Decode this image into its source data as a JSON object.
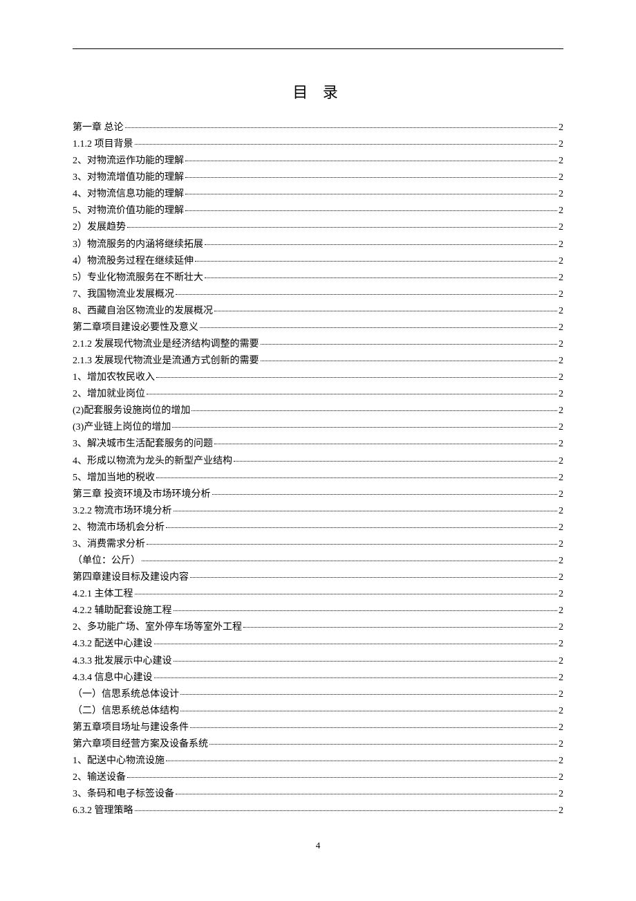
{
  "title": "目 录",
  "page_number": "4",
  "toc": [
    {
      "label": "第一章  总论",
      "page": "2"
    },
    {
      "label": "1.1.2   项目背景",
      "page": "2"
    },
    {
      "label": "2、对物流运作功能的理解",
      "page": "2"
    },
    {
      "label": "3、对物流增值功能的理解",
      "page": "2"
    },
    {
      "label": "4、对物流信息功能的理解",
      "page": "2"
    },
    {
      "label": "5、对物流价值功能的理解",
      "page": "2"
    },
    {
      "label": "2）发展趋势",
      "page": "2"
    },
    {
      "label": "3）物流服务的内涵将继续拓展",
      "page": "2"
    },
    {
      "label": "4）物流股务过程在继续延伸",
      "page": "2"
    },
    {
      "label": "5）专业化物流服务在不断壮大",
      "page": "2"
    },
    {
      "label": "7、我国物流业发展概况",
      "page": "2"
    },
    {
      "label": "8、西藏自治区物流业的发展概况",
      "page": "2"
    },
    {
      "label": "第二章项目建设必要性及意义",
      "page": "2"
    },
    {
      "label": "2.1.2 发展现代物流业是经济结构调整的需要",
      "page": "2"
    },
    {
      "label": "2.1.3 发展现代物流业是流通方式创新的需要",
      "page": "2"
    },
    {
      "label": "1、增加农牧民收入",
      "page": "2"
    },
    {
      "label": "2、增加就业岗位",
      "page": "2"
    },
    {
      "label": "(2)配套服务设施岗位的增加",
      "page": "2"
    },
    {
      "label": "(3)产业链上岗位的增加",
      "page": "2"
    },
    {
      "label": "3、解决城市生活配套服务的问题",
      "page": "2"
    },
    {
      "label": "4、形成以物流为龙头的新型产业结构",
      "page": "2"
    },
    {
      "label": "5、增加当地的税收",
      "page": "2"
    },
    {
      "label": "第三章   投资环境及市场环境分析",
      "page": "2"
    },
    {
      "label": "3.2.2 物流市场环境分析",
      "page": "2"
    },
    {
      "label": "2、物流市场机会分析",
      "page": "2"
    },
    {
      "label": "3、消费需求分析",
      "page": "2"
    },
    {
      "label": "（单位：公斤）",
      "page": "2"
    },
    {
      "label": "第四章建设目标及建设内容",
      "page": "2"
    },
    {
      "label": "4.2.1 主体工程",
      "page": "2"
    },
    {
      "label": "4.2.2 辅助配套设施工程",
      "page": "2"
    },
    {
      "label": "2、多功能广场、室外停车场等室外工程",
      "page": "2"
    },
    {
      "label": "4.3.2 配送中心建设",
      "page": "2"
    },
    {
      "label": "4.3.3 批发展示中心建设",
      "page": "2"
    },
    {
      "label": "4.3.4 信息中心建设",
      "page": "2"
    },
    {
      "label": "（一）信思系统总体设计",
      "page": "2"
    },
    {
      "label": "（二）信思系统总体结构",
      "page": "2"
    },
    {
      "label": "第五章项目场址与建设条件",
      "page": "2"
    },
    {
      "label": "第六章项目经营方案及设备系统",
      "page": "2"
    },
    {
      "label": "1、配送中心物流设施",
      "page": "2"
    },
    {
      "label": "2、输送设备",
      "page": "2"
    },
    {
      "label": "3、条码和电子标签设备",
      "page": "2"
    },
    {
      "label": "6.3.2 管理策略",
      "page": "2"
    }
  ]
}
